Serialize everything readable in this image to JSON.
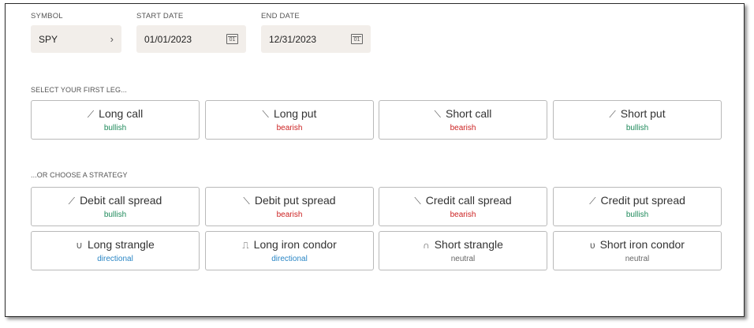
{
  "form": {
    "symbol_label": "SYMBOL",
    "symbol_value": "SPY",
    "start_label": "START DATE",
    "start_value": "01/01/2023",
    "end_label": "END DATE",
    "end_value": "12/31/2023",
    "calendar_glyph": "01"
  },
  "legs": {
    "heading": "SELECT YOUR FIRST LEG...",
    "items": [
      {
        "label": "Long call",
        "bias": "bullish",
        "icon": "⟋"
      },
      {
        "label": "Long put",
        "bias": "bearish",
        "icon": "⟍"
      },
      {
        "label": "Short call",
        "bias": "bearish",
        "icon": "⟍"
      },
      {
        "label": "Short put",
        "bias": "bullish",
        "icon": "⟋"
      }
    ]
  },
  "strategies": {
    "heading": "...OR CHOOSE A STRATEGY",
    "items": [
      {
        "label": "Debit call spread",
        "bias": "bullish",
        "icon": "⟋"
      },
      {
        "label": "Debit put spread",
        "bias": "bearish",
        "icon": "⟍"
      },
      {
        "label": "Credit call spread",
        "bias": "bearish",
        "icon": "⟍"
      },
      {
        "label": "Credit put spread",
        "bias": "bullish",
        "icon": "⟋"
      },
      {
        "label": "Long strangle",
        "bias": "directional",
        "icon": "∪"
      },
      {
        "label": "Long iron condor",
        "bias": "directional",
        "icon": "⎍"
      },
      {
        "label": "Short strangle",
        "bias": "neutral",
        "icon": "∩"
      },
      {
        "label": "Short iron condor",
        "bias": "neutral",
        "icon": "υ"
      }
    ]
  },
  "colors": {
    "bullish": "#1f8a5b",
    "bearish": "#cc2222",
    "directional": "#2a86c5",
    "neutral": "#666666",
    "field_bg": "#f2eeea"
  }
}
